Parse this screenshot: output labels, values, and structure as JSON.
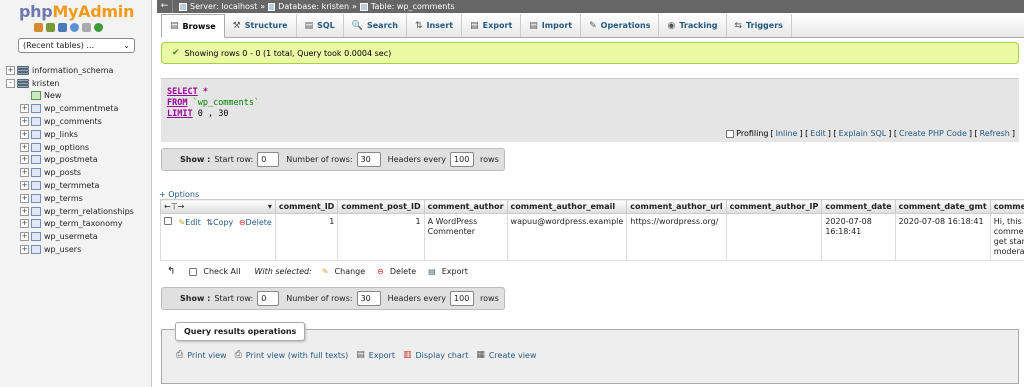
{
  "nav": {
    "logo_php": "php",
    "logo_myadmin": "MyAdmin",
    "recent": "(Recent tables) ...",
    "tree": [
      {
        "label": "information_schema",
        "toggle": "+",
        "level": 0,
        "kind": "db"
      },
      {
        "label": "kristen",
        "toggle": "-",
        "level": 0,
        "kind": "db"
      },
      {
        "label": "New",
        "toggle": "",
        "level": 1,
        "kind": "new"
      },
      {
        "label": "wp_commentmeta",
        "toggle": "+",
        "level": 1,
        "kind": "table"
      },
      {
        "label": "wp_comments",
        "toggle": "+",
        "level": 1,
        "kind": "table"
      },
      {
        "label": "wp_links",
        "toggle": "+",
        "level": 1,
        "kind": "table"
      },
      {
        "label": "wp_options",
        "toggle": "+",
        "level": 1,
        "kind": "table"
      },
      {
        "label": "wp_postmeta",
        "toggle": "+",
        "level": 1,
        "kind": "table"
      },
      {
        "label": "wp_posts",
        "toggle": "+",
        "level": 1,
        "kind": "table"
      },
      {
        "label": "wp_termmeta",
        "toggle": "+",
        "level": 1,
        "kind": "table"
      },
      {
        "label": "wp_terms",
        "toggle": "+",
        "level": 1,
        "kind": "table"
      },
      {
        "label": "wp_term_relationships",
        "toggle": "+",
        "level": 1,
        "kind": "table"
      },
      {
        "label": "wp_term_taxonomy",
        "toggle": "+",
        "level": 1,
        "kind": "table"
      },
      {
        "label": "wp_usermeta",
        "toggle": "+",
        "level": 1,
        "kind": "table"
      },
      {
        "label": "wp_users",
        "toggle": "+",
        "level": 1,
        "kind": "table"
      }
    ]
  },
  "breadcrumb": {
    "server": "Server: localhost",
    "sep1": "»",
    "database": "Database: kristen",
    "sep2": "»",
    "table": "Table: wp_comments"
  },
  "tabs": [
    {
      "label": "Browse",
      "icon": "▤"
    },
    {
      "label": "Structure",
      "icon": "⚒"
    },
    {
      "label": "SQL",
      "icon": "▤"
    },
    {
      "label": "Search",
      "icon": "🔍"
    },
    {
      "label": "Insert",
      "icon": "⇅"
    },
    {
      "label": "Export",
      "icon": "▤"
    },
    {
      "label": "Import",
      "icon": "▤"
    },
    {
      "label": "Operations",
      "icon": "✎"
    },
    {
      "label": "Tracking",
      "icon": "◉"
    },
    {
      "label": "Triggers",
      "icon": "⇆"
    }
  ],
  "success_message": "Showing rows 0 - 0 (1 total, Query took 0.0004 sec)",
  "sql": {
    "select": "SELECT",
    "star": " *",
    "from": "FROM",
    "table": " `wp_comments`",
    "limit": "LIMIT",
    "limit_a": " 0",
    "comma": " ,",
    "limit_b": " 30"
  },
  "sql_links": {
    "profiling": "Profiling",
    "inline": "Inline",
    "edit": "Edit",
    "explain": "Explain SQL",
    "create_php": "Create PHP Code",
    "refresh": "Refresh"
  },
  "pager": {
    "show": "Show :",
    "start_row_label": "Start row:",
    "start_row": "0",
    "num_rows_label": "Number of rows:",
    "num_rows": "30",
    "headers_every_label": "Headers every",
    "headers_every": "100",
    "rows_label": "rows"
  },
  "options_link": "+ Options",
  "table": {
    "columns": [
      "comment_ID",
      "comment_post_ID",
      "comment_author",
      "comment_author_email",
      "comment_author_url",
      "comment_author_IP",
      "comment_date",
      "comment_date_gmt",
      "comment_co"
    ],
    "row": {
      "edit": "Edit",
      "copy": "Copy",
      "delete": "Delete",
      "comment_ID": "1",
      "comment_post_ID": "1",
      "comment_author": "A WordPress Commenter",
      "comment_author_email": "wapuu@wordpress.example",
      "comment_author_url": "https://wordpress.org/",
      "comment_author_IP": "",
      "comment_date": "2020-07-08 16:18:41",
      "comment_date_gmt": "2020-07-08 16:18:41",
      "comment_content": "Hi, this is a comment. To get started moderat..."
    }
  },
  "with_selected": {
    "check_all": "Check All",
    "label": "With selected:",
    "change": "Change",
    "delete": "Delete",
    "export": "Export"
  },
  "query_ops": {
    "title": "Query results operations",
    "print_view": "Print view",
    "print_full": "Print view (with full texts)",
    "export": "Export",
    "display_chart": "Display chart",
    "create_view": "Create view"
  }
}
